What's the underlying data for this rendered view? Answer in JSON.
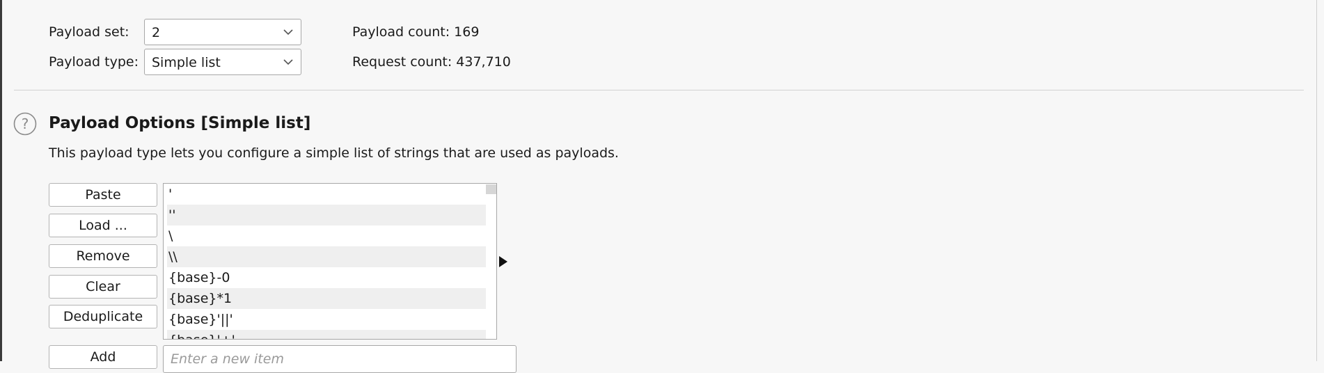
{
  "payload_sets": {
    "set_label": "Payload set:",
    "set_value": "2",
    "type_label": "Payload type:",
    "type_value": "Simple list",
    "payload_count": "Payload count: 169",
    "request_count": "Request count: 437,710"
  },
  "payload_options": {
    "title": "Payload Options [Simple list]",
    "description": "This payload type lets you configure a simple list of strings that are used as payloads.",
    "buttons": {
      "paste": "Paste",
      "load": "Load ...",
      "remove": "Remove",
      "clear": "Clear",
      "deduplicate": "Deduplicate",
      "add": "Add"
    },
    "list_items": [
      "'",
      "''",
      "\\",
      "\\\\",
      "{base}-0",
      "{base}*1",
      "{base}'||'",
      "{base}'+'"
    ],
    "new_item_placeholder": "Enter a new item"
  },
  "icons": {
    "help": "help-circle-icon",
    "dropdown": "chevron-down-icon",
    "expand": "triangle-right-icon"
  }
}
